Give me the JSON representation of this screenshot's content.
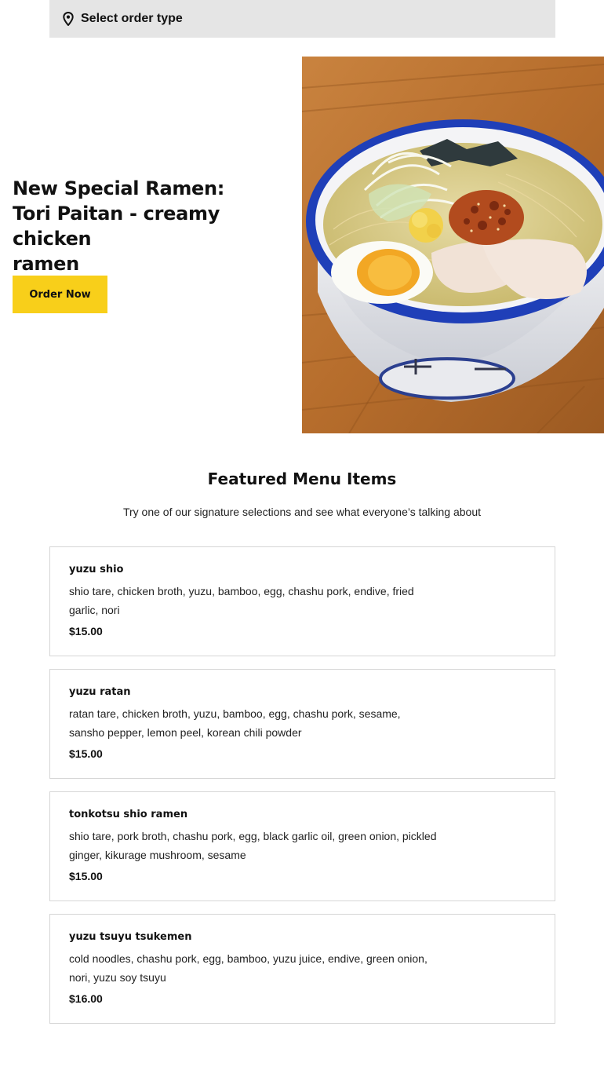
{
  "order_type": {
    "label": "Select order type",
    "icon": "map-pin-icon"
  },
  "hero": {
    "title_line1": "New Special Ramen:",
    "title_line2": "Tori Paitan - creamy chicken",
    "title_line3": "ramen",
    "button_label": "Order Now",
    "button_color": "#f8cf1a"
  },
  "featured": {
    "title": "Featured Menu Items",
    "subtitle": "Try one of our signature selections and see what everyone’s talking about",
    "items": [
      {
        "name": "yuzu shio",
        "description": "shio tare, chicken broth, yuzu, bamboo, egg, chashu pork, endive, fried garlic, nori",
        "price": "$15.00"
      },
      {
        "name": "yuzu ratan",
        "description": "ratan tare, chicken broth, yuzu, bamboo, egg, chashu pork, sesame, sansho pepper, lemon peel, korean chili powder",
        "price": "$15.00"
      },
      {
        "name": "tonkotsu shio ramen",
        "description": "shio tare, pork broth, chashu pork, egg, black garlic oil, green onion, pickled ginger, kikurage mushroom, sesame",
        "price": "$15.00"
      },
      {
        "name": "yuzu tsuyu tsukemen",
        "description": "cold noodles, chashu pork, egg, bamboo, yuzu juice, endive, green onion, nori, yuzu soy tsuyu",
        "price": "$16.00"
      }
    ]
  }
}
